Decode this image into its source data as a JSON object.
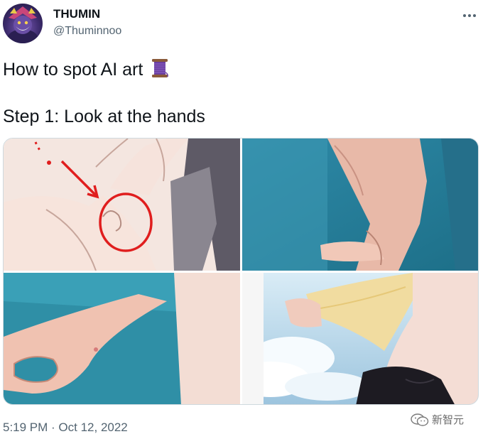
{
  "tweet": {
    "author": {
      "display_name": "THUMIN",
      "handle": "@Thuminnoo"
    },
    "text_line1": "How to spot AI art",
    "text_line1_emoji": "spool-of-thread-emoji",
    "text_line2": "Step 1: Look at the hands",
    "timestamp": "5:19 PM · Oct 12, 2022",
    "media_count": 4
  },
  "watermark": {
    "label": "新智元"
  },
  "colors": {
    "text_primary": "#0f1419",
    "text_secondary": "#536471",
    "border": "#cfd9de",
    "annotation_red": "#e01e1e"
  },
  "icons": {
    "more": "more-horizontal-icon",
    "emoji": "spool-of-thread-emoji"
  }
}
